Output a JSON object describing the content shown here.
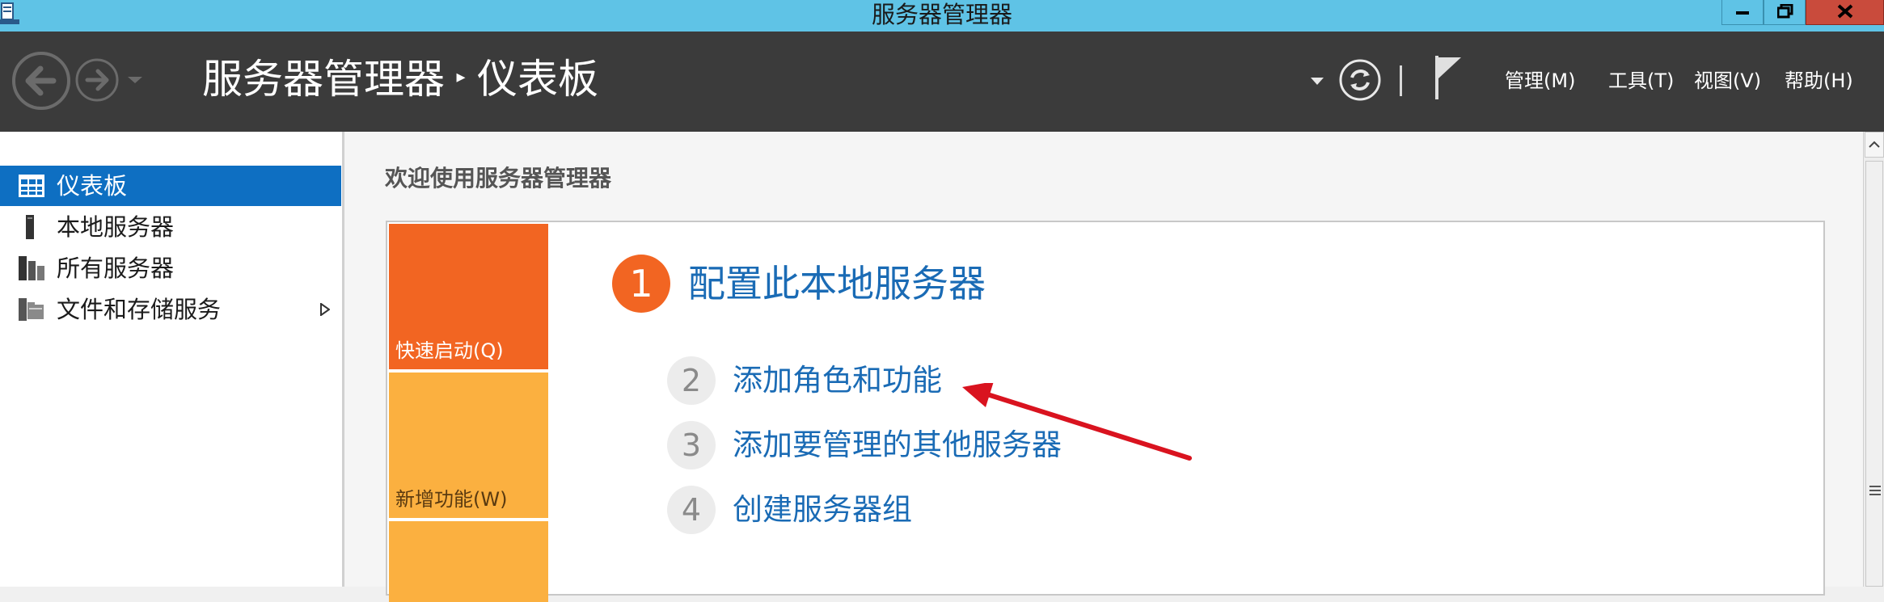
{
  "window": {
    "title": "服务器管理器"
  },
  "header": {
    "breadcrumb": {
      "app": "服务器管理器",
      "separator": "▸",
      "page": "仪表板"
    },
    "menus": [
      {
        "label": "管理(M)"
      },
      {
        "label": "工具(T)"
      },
      {
        "label": "视图(V)"
      },
      {
        "label": "帮助(H)"
      }
    ]
  },
  "sidebar": {
    "items": [
      {
        "label": "仪表板",
        "selected": true,
        "icon": "dashboard-icon"
      },
      {
        "label": "本地服务器",
        "selected": false,
        "icon": "server-icon"
      },
      {
        "label": "所有服务器",
        "selected": false,
        "icon": "servers-icon"
      },
      {
        "label": "文件和存储服务",
        "selected": false,
        "icon": "file-storage-icon",
        "expandable": true
      }
    ]
  },
  "main": {
    "welcome_title": "欢迎使用服务器管理器",
    "tiles": [
      {
        "label": "快速启动(Q)"
      },
      {
        "label": "新增功能(W)"
      }
    ],
    "steps": [
      {
        "number": "1",
        "label": "配置此本地服务器"
      },
      {
        "number": "2",
        "label": "添加角色和功能"
      },
      {
        "number": "3",
        "label": "添加要管理的其他服务器"
      },
      {
        "number": "4",
        "label": "创建服务器组"
      }
    ]
  },
  "colors": {
    "titlebar": "#5fc3e6",
    "header": "#3b3b3b",
    "selection": "#0e6fc2",
    "accent_orange": "#f26522",
    "tile_yellow": "#fbb040",
    "link_blue": "#1a6bb5",
    "annotation_arrow": "#d9131f"
  }
}
